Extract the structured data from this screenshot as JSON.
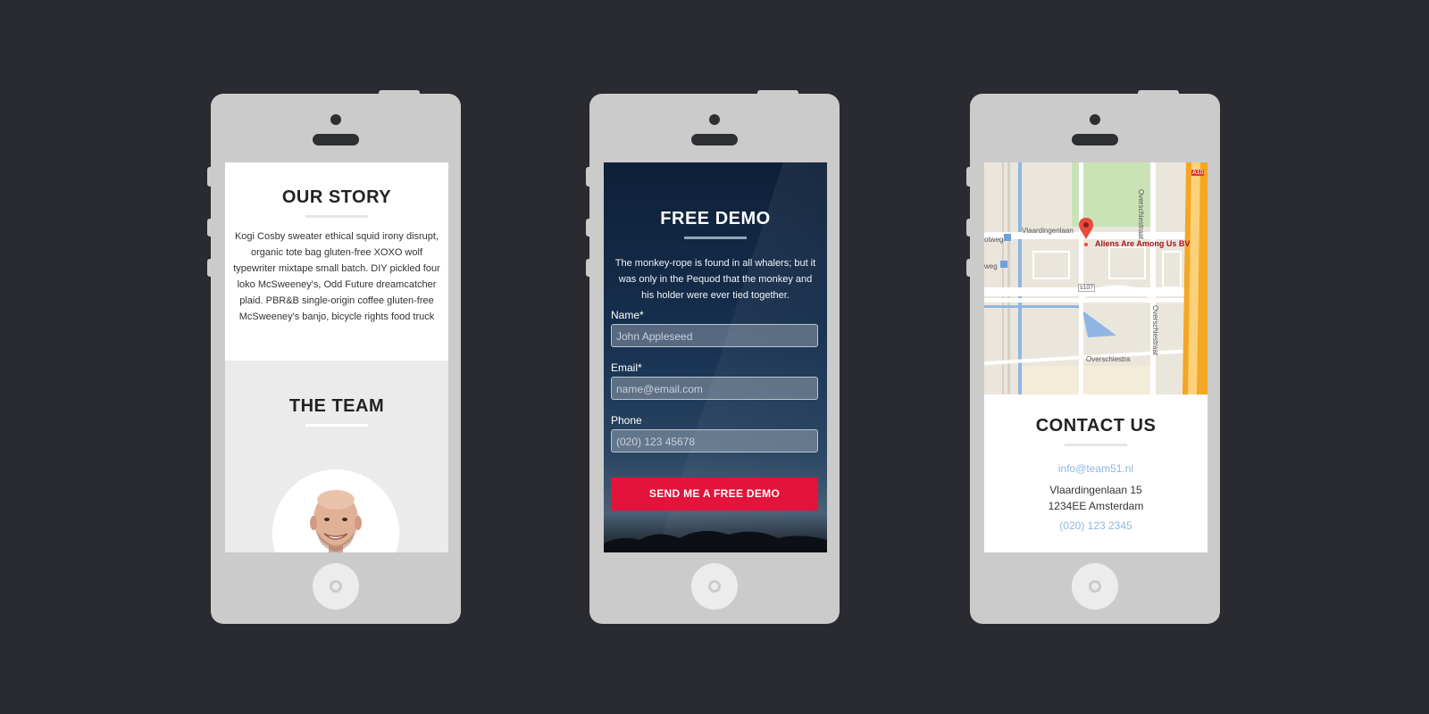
{
  "story": {
    "title": "OUR STORY",
    "text": "Kogi Cosby sweater ethical squid irony disrupt, organic tote bag gluten-free XOXO wolf typewriter mixtape small batch. DIY pickled four loko McSweeney's, Odd Future dreamcatcher plaid. PBR&B single-origin coffee gluten-free McSweeney's banjo, bicycle rights food truck"
  },
  "team": {
    "title": "THE TEAM"
  },
  "demo": {
    "title": "FREE DEMO",
    "lead": "The monkey-rope is found in all whalers; but it was only in the Pequod that the monkey and his holder were ever tied together.",
    "name_label": "Name*",
    "name_placeholder": "John Appleseed",
    "email_label": "Email*",
    "email_placeholder": "name@email.com",
    "phone_label": "Phone",
    "phone_placeholder": "(020) 123 45678",
    "submit_label": "SEND ME A FREE DEMO"
  },
  "map": {
    "marker_label": "Aliens Are Among Us BV",
    "street_1": "Vlaardingenlaan",
    "street_2": "Overschiestraat",
    "street_3": "Overschiestra",
    "street_4": "Overschiestraat",
    "street_5": "otweg",
    "street_6": "weg",
    "road_code": "s107",
    "road_code_2": "A10"
  },
  "contact": {
    "title": "CONTACT US",
    "email": "info@team51.nl",
    "address_line1": "Vlaardingenlaan 15",
    "address_line2": "1234EE Amsterdam",
    "phone": "(020) 123 2345"
  },
  "colors": {
    "background": "#2a2b30",
    "phone_body": "#cbcbcb",
    "accent_red": "#e3133b",
    "link_blue": "#8fb6e3"
  }
}
